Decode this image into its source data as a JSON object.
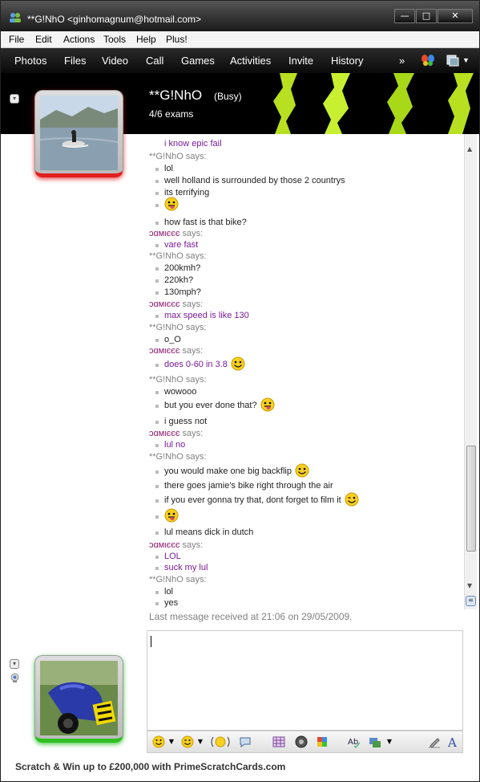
{
  "window": {
    "title": "**G!NhO <ginhomagnum@hotmail.com>"
  },
  "menu": [
    "File",
    "Edit",
    "Actions",
    "Tools",
    "Help",
    "Plus!"
  ],
  "toolbar": {
    "items": [
      "Photos",
      "Files",
      "Video",
      "Call",
      "Games",
      "Activities",
      "Invite",
      "History"
    ],
    "more": "»"
  },
  "contact": {
    "name": "**G!NhO",
    "status": "(Busy)",
    "personal_message": "4/6 exams"
  },
  "chat": {
    "partial_top": "i know epic fail",
    "lines": [
      {
        "kind": "says",
        "sender": "**G!NhO",
        "text": " says:"
      },
      {
        "kind": "msg",
        "who": "g",
        "text": "lol"
      },
      {
        "kind": "msg",
        "who": "g",
        "text": "well holland is surrounded by those 2 countrys"
      },
      {
        "kind": "msg",
        "who": "g",
        "text": "its terrifying"
      },
      {
        "kind": "msg",
        "who": "g",
        "text": "",
        "emoticon": "tongue"
      },
      {
        "kind": "msg",
        "who": "g",
        "text": "how fast is that bike?"
      },
      {
        "kind": "says",
        "sender": "ɔɑмιєєє",
        "text": " says:",
        "jamie": true
      },
      {
        "kind": "msg",
        "who": "j",
        "text": "vare fast"
      },
      {
        "kind": "says",
        "sender": "**G!NhO",
        "text": " says:"
      },
      {
        "kind": "msg",
        "who": "g",
        "text": "200kmh?"
      },
      {
        "kind": "msg",
        "who": "g",
        "text": "220kh?"
      },
      {
        "kind": "msg",
        "who": "g",
        "text": "130mph?"
      },
      {
        "kind": "says",
        "sender": "ɔɑмιєєє",
        "text": " says:",
        "jamie": true
      },
      {
        "kind": "msg",
        "who": "j",
        "text": "max speed is like 130"
      },
      {
        "kind": "says",
        "sender": "**G!NhO",
        "text": " says:"
      },
      {
        "kind": "msg",
        "who": "g",
        "text": "o_O"
      },
      {
        "kind": "says",
        "sender": "ɔɑмιєєє",
        "text": " says:",
        "jamie": true
      },
      {
        "kind": "msg",
        "who": "j",
        "text": "does 0-60 in 3.8",
        "emoticon": "smile"
      },
      {
        "kind": "says",
        "sender": "**G!NhO",
        "text": " says:"
      },
      {
        "kind": "msg",
        "who": "g",
        "text": "wowooo"
      },
      {
        "kind": "msg",
        "who": "g",
        "text": "but you ever done that?",
        "emoticon": "tongue"
      },
      {
        "kind": "msg",
        "who": "g",
        "text": "i guess not"
      },
      {
        "kind": "says",
        "sender": "ɔɑмιєєє",
        "text": " says:",
        "jamie": true
      },
      {
        "kind": "msg",
        "who": "j",
        "text": "lul no"
      },
      {
        "kind": "says",
        "sender": "**G!NhO",
        "text": " says:"
      },
      {
        "kind": "msg",
        "who": "g",
        "text": "you would make one big backflip",
        "emoticon": "smile"
      },
      {
        "kind": "msg",
        "who": "g",
        "text": "there goes jamie's bike right through the air"
      },
      {
        "kind": "msg",
        "who": "g",
        "text": "if you ever gonna try that, dont forget to film it",
        "emoticon": "wink"
      },
      {
        "kind": "msg",
        "who": "g",
        "text": "",
        "emoticon": "tongue"
      },
      {
        "kind": "msg",
        "who": "g",
        "text": "lul means dick in dutch"
      },
      {
        "kind": "says",
        "sender": "ɔɑмιєєє",
        "text": " says:",
        "jamie": true
      },
      {
        "kind": "msg",
        "who": "j",
        "text": "LOL"
      },
      {
        "kind": "msg",
        "who": "j",
        "text": "suck my lul"
      },
      {
        "kind": "says",
        "sender": "**G!NhO",
        "text": " says:"
      },
      {
        "kind": "msg",
        "who": "g",
        "text": "lol"
      },
      {
        "kind": "msg",
        "who": "g",
        "text": "yes"
      }
    ],
    "last_message": "Last message received at 21:06 on 29/05/2009."
  },
  "ad": {
    "text": "Scratch & Win up to £200,000 with PrimeScratchCards.com"
  },
  "colors": {
    "busy_red": "#e02020",
    "online_green": "#2ec020",
    "jamie_purple": "#7a1a9a"
  }
}
